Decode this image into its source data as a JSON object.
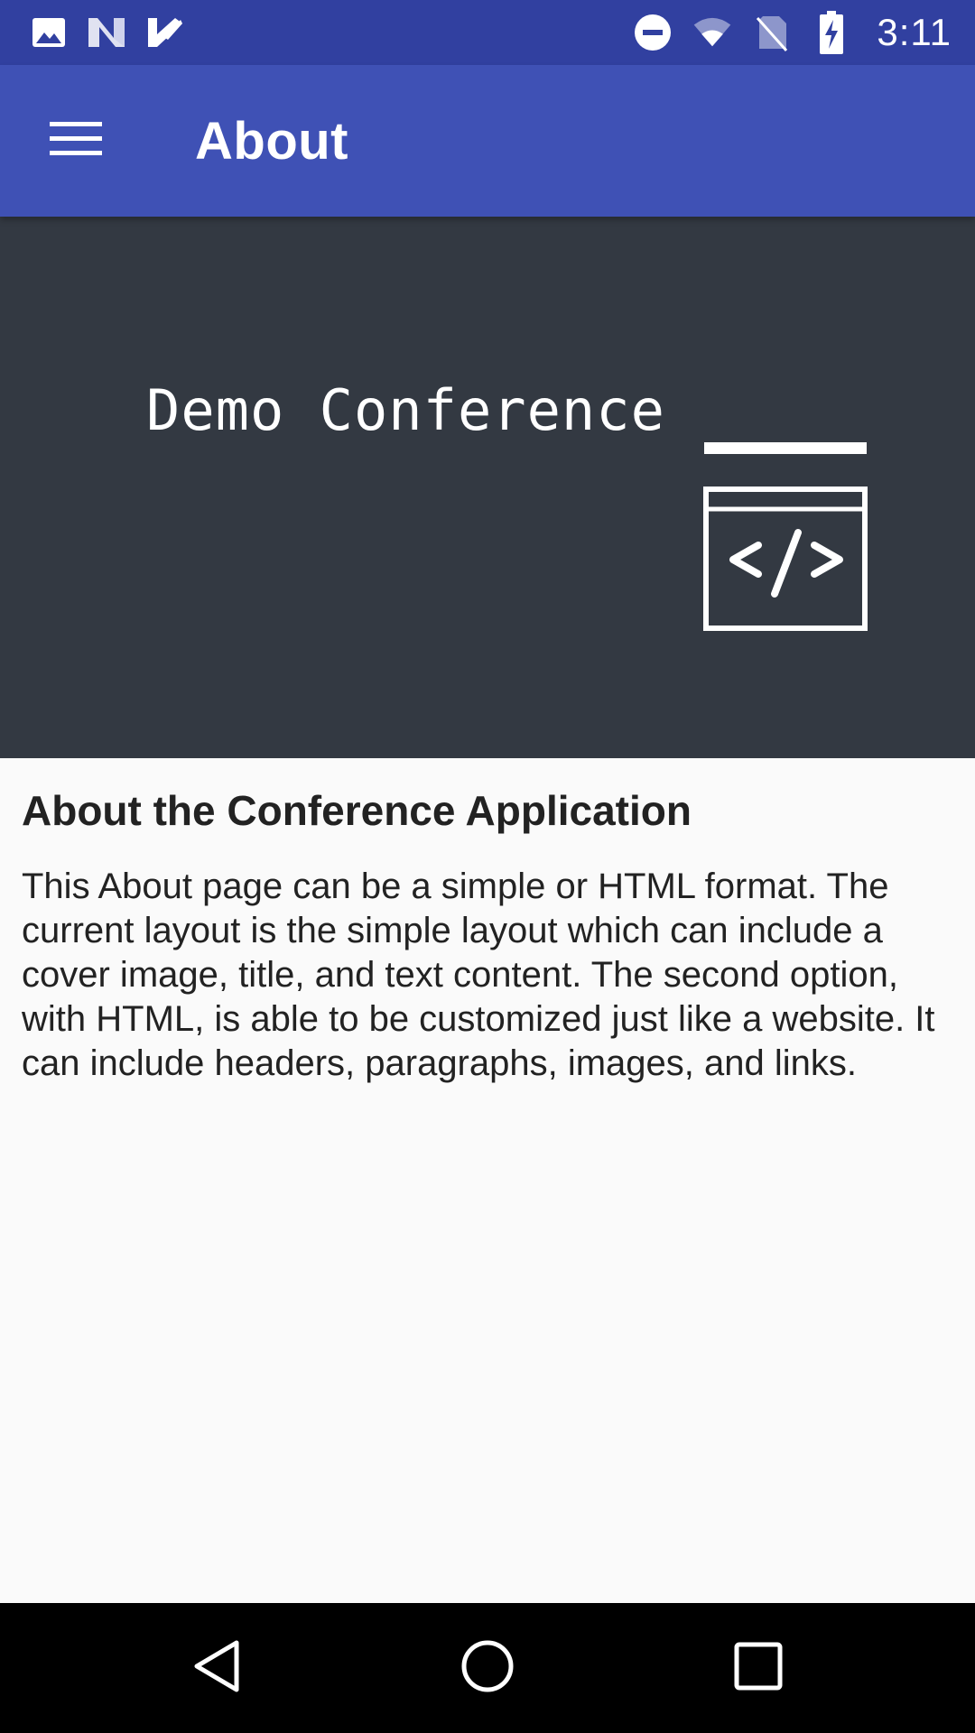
{
  "status_bar": {
    "time": "3:11",
    "left_icons": [
      "image-notification-icon",
      "n-notification-icon",
      "task-notification-icon"
    ],
    "right_icons": [
      "do-not-disturb-icon",
      "wifi-icon",
      "no-sim-icon",
      "battery-charging-icon"
    ],
    "background": "#3140a0"
  },
  "app_bar": {
    "title": "About",
    "menu_icon": "hamburger-menu-icon",
    "background": "#3f51b5"
  },
  "cover": {
    "title": "Demo Conference",
    "logo_icon": "code-window-icon",
    "background": "#333942"
  },
  "content": {
    "heading": "About the Conference Application",
    "body": "This About page can be a simple or HTML format. The current layout is the simple layout which can include a cover image, title, and text content. The second option, with HTML, is able to be customized just like a website. It can include headers, paragraphs, images, and links."
  },
  "nav_bar": {
    "buttons": [
      "back-icon",
      "home-icon",
      "recents-icon"
    ]
  }
}
